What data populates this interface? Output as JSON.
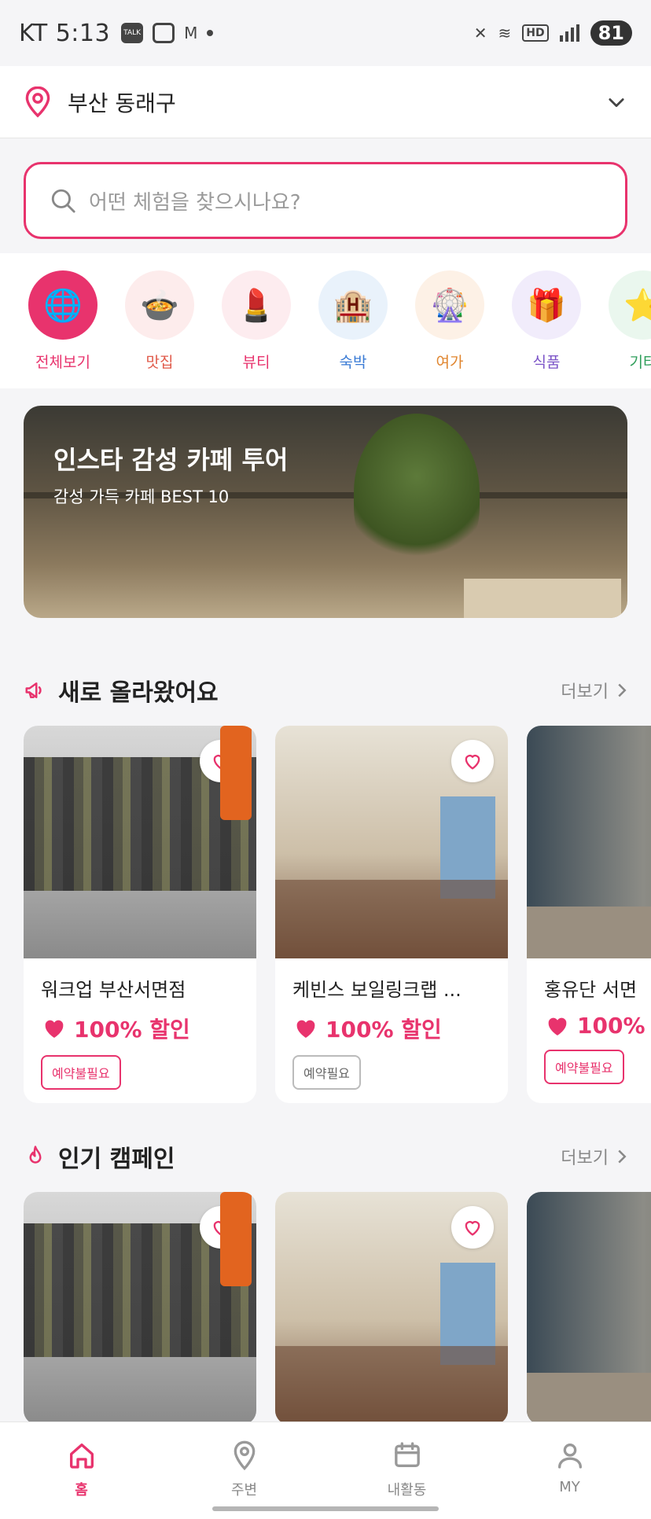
{
  "status_bar": {
    "carrier_time": "KT 5:13",
    "battery": "81",
    "hd": "HD"
  },
  "location": {
    "label": "부산 동래구",
    "pin_icon": "map-pin-icon",
    "accent": "#e8336d"
  },
  "search": {
    "placeholder": "어떤 체험을 찾으시나요?"
  },
  "categories": [
    {
      "label": "전체보기",
      "icon": "globe-icon",
      "glyph": "🌐",
      "bg": "#e8336d",
      "color": "#e8336d"
    },
    {
      "label": "맛집",
      "icon": "food-icon",
      "glyph": "🍲",
      "bg": "#fdecec",
      "color": "#e05a4a"
    },
    {
      "label": "뷰티",
      "icon": "lipstick-icon",
      "glyph": "💄",
      "bg": "#fdecef",
      "color": "#e8336d"
    },
    {
      "label": "숙박",
      "icon": "hotel-icon",
      "glyph": "🏨",
      "bg": "#e9f2fb",
      "color": "#3a7bd5"
    },
    {
      "label": "여가",
      "icon": "ferris-wheel-icon",
      "glyph": "🎡",
      "bg": "#fdf1e6",
      "color": "#e0852e"
    },
    {
      "label": "식품",
      "icon": "gift-icon",
      "glyph": "🎁",
      "bg": "#f1ecfb",
      "color": "#7a52c7"
    },
    {
      "label": "기타",
      "icon": "star-icon",
      "glyph": "⭐",
      "bg": "#eaf7ee",
      "color": "#2f9e5a"
    }
  ],
  "banner": {
    "title": "인스타 감성 카페 투어",
    "subtitle": "감성 가득 카페 BEST 10"
  },
  "new_section": {
    "title": "새로 올라왔어요",
    "more": "더보기",
    "cards": [
      {
        "name": "워크업 부산서면점",
        "discount": "100% 할인",
        "badge": "예약불필요",
        "badge_style": "pink",
        "image": "clothes"
      },
      {
        "name": "케빈스 보일링크랩 ...",
        "discount": "100% 할인",
        "badge": "예약필요",
        "badge_style": "gray",
        "image": "cafe"
      },
      {
        "name": "홍유단 서면",
        "discount": "100%",
        "badge": "예약불필요",
        "badge_style": "pink",
        "image": "hall"
      }
    ]
  },
  "popular_section": {
    "title": "인기 캠페인",
    "more": "더보기",
    "cards": [
      {
        "image": "clothes"
      },
      {
        "image": "cafe"
      },
      {
        "image": "hall"
      }
    ]
  },
  "bottom_nav": [
    {
      "label": "홈",
      "icon": "home-icon",
      "active": true
    },
    {
      "label": "주변",
      "icon": "location-icon",
      "active": false
    },
    {
      "label": "내활동",
      "icon": "calendar-icon",
      "active": false
    },
    {
      "label": "MY",
      "icon": "user-icon",
      "active": false
    }
  ]
}
